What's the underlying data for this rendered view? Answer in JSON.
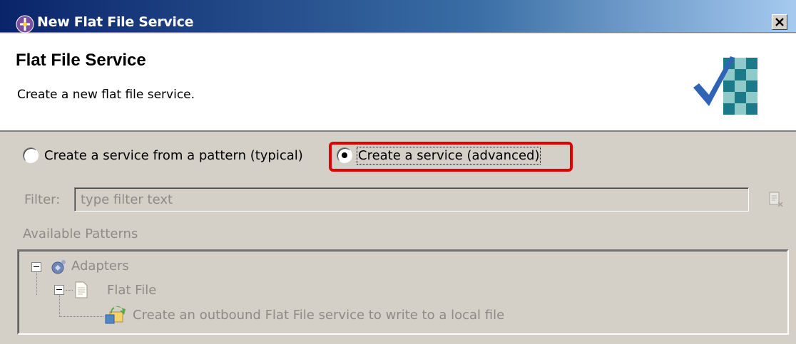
{
  "window": {
    "title": "New Flat File Service"
  },
  "banner": {
    "heading": "Flat File Service",
    "description": "Create a new flat file service."
  },
  "options": {
    "pattern_label": "Create a service from a pattern (typical)",
    "advanced_label": "Create a service (advanced)",
    "selected": "advanced"
  },
  "filter": {
    "label": "Filter:",
    "placeholder": "type filter text",
    "value": ""
  },
  "patterns": {
    "label": "Available Patterns",
    "tree": [
      {
        "label": "Adapters",
        "icon": "adapters-icon"
      },
      {
        "label": "Flat File",
        "icon": "document-icon"
      },
      {
        "label": "Create an outbound Flat File service to write to a local file",
        "icon": "outbound-service-icon"
      }
    ]
  },
  "colors": {
    "highlight": "#e00000",
    "disabled_text": "#8f8b84",
    "titlebar_start": "#0a246a",
    "titlebar_end": "#a6caf0"
  }
}
